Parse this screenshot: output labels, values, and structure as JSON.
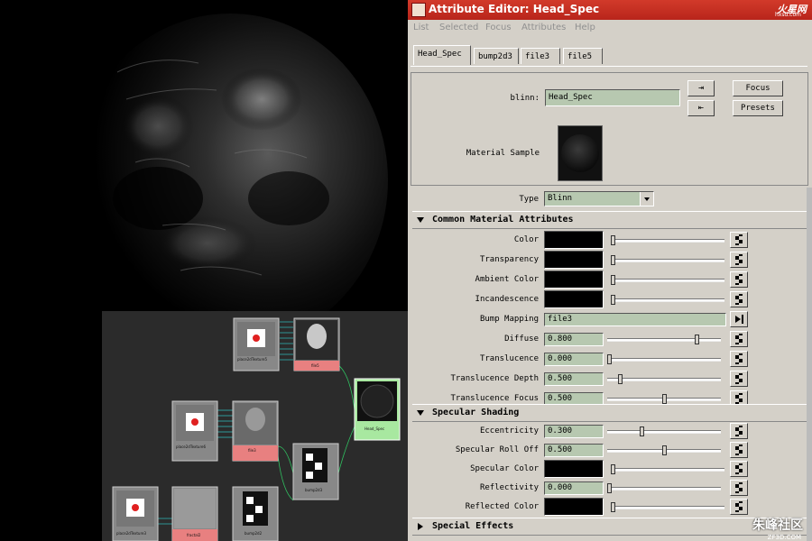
{
  "window": {
    "title": "Attribute Editor: Head_Spec",
    "logo": "火星网",
    "logo_sub": "hxsd.com"
  },
  "menu": [
    "List",
    "Selected",
    "Focus",
    "Attributes",
    "Help"
  ],
  "tabs": [
    "Head_Spec",
    "bump2d3",
    "file3",
    "file5"
  ],
  "header": {
    "node_type_label": "blinn:",
    "node_name": "Head_Spec",
    "focus_label": "Focus",
    "presets_label": "Presets",
    "material_sample_label": "Material Sample"
  },
  "type_row": {
    "label": "Type",
    "value": "Blinn"
  },
  "sections": {
    "common": "Common Material Attributes",
    "specular": "Specular Shading",
    "special": "Special Effects"
  },
  "common_rows": [
    {
      "label": "Color",
      "kind": "swatch",
      "slider": 0.0
    },
    {
      "label": "Transparency",
      "kind": "swatch",
      "slider": 0.0
    },
    {
      "label": "Ambient Color",
      "kind": "swatch",
      "slider": 0.0
    },
    {
      "label": "Incandescence",
      "kind": "swatch",
      "slider": 0.0
    },
    {
      "label": "Bump Mapping",
      "kind": "text",
      "value": "file3"
    },
    {
      "label": "Diffuse",
      "kind": "number",
      "value": "0.800",
      "slider": 0.8
    },
    {
      "label": "Translucence",
      "kind": "number",
      "value": "0.000",
      "slider": 0.0
    },
    {
      "label": "Translucence Depth",
      "kind": "number",
      "value": "0.500",
      "slider": 0.1
    },
    {
      "label": "Translucence Focus",
      "kind": "number",
      "value": "0.500",
      "slider": 0.5
    }
  ],
  "specular_rows": [
    {
      "label": "Eccentricity",
      "kind": "number",
      "value": "0.300",
      "slider": 0.3
    },
    {
      "label": "Specular Roll Off",
      "kind": "number",
      "value": "0.500",
      "slider": 0.5
    },
    {
      "label": "Specular Color",
      "kind": "swatch",
      "slider": 0.0
    },
    {
      "label": "Reflectivity",
      "kind": "number",
      "value": "0.000",
      "slider": 0.0
    },
    {
      "label": "Reflected Color",
      "kind": "swatch",
      "slider": 0.0
    }
  ],
  "hypershade": {
    "nodes": [
      "place2dTexture5",
      "file5",
      "place2dTexture6",
      "file3",
      "place2dTexture3",
      "fractal2",
      "bump2d3",
      "bump2d2",
      "Head_Spec"
    ]
  },
  "watermark": {
    "text": "朱峰社区",
    "sub": "ZF3D.COM"
  },
  "colors": {
    "title_bar": "#c32e22",
    "field_green": "#b7c8b0",
    "panel_gray": "#d4d0c8",
    "file_node": "#e88080",
    "shader_node": "#a8e8a0"
  }
}
